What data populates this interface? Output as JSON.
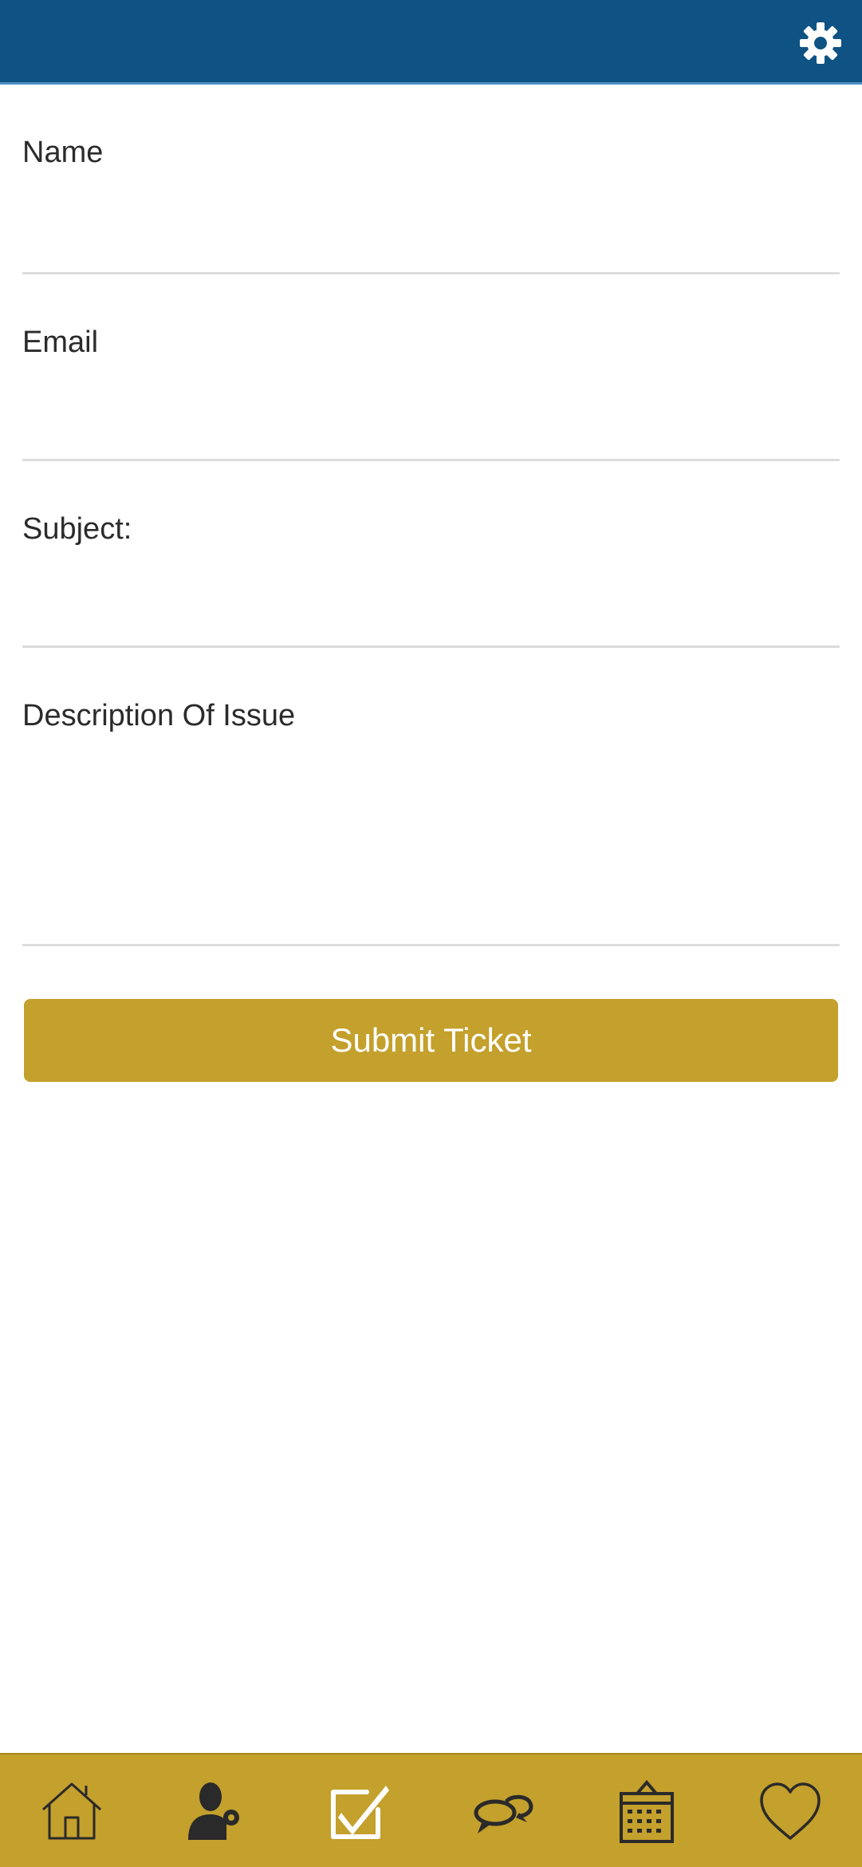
{
  "header": {
    "settings_icon": "gear-icon",
    "background_color": "#0e5384"
  },
  "form": {
    "name_label": "Name",
    "name_value": "",
    "email_label": "Email",
    "email_value": "",
    "subject_label": "Subject:",
    "subject_value": "",
    "description_label": "Description Of Issue",
    "description_value": ""
  },
  "submit": {
    "label": "Submit Ticket",
    "color": "#c4a02c"
  },
  "bottom_nav": {
    "items": [
      {
        "icon": "home-icon"
      },
      {
        "icon": "user-key-icon"
      },
      {
        "icon": "checkbox-icon"
      },
      {
        "icon": "chat-icon"
      },
      {
        "icon": "calendar-icon"
      },
      {
        "icon": "heart-icon"
      }
    ]
  }
}
